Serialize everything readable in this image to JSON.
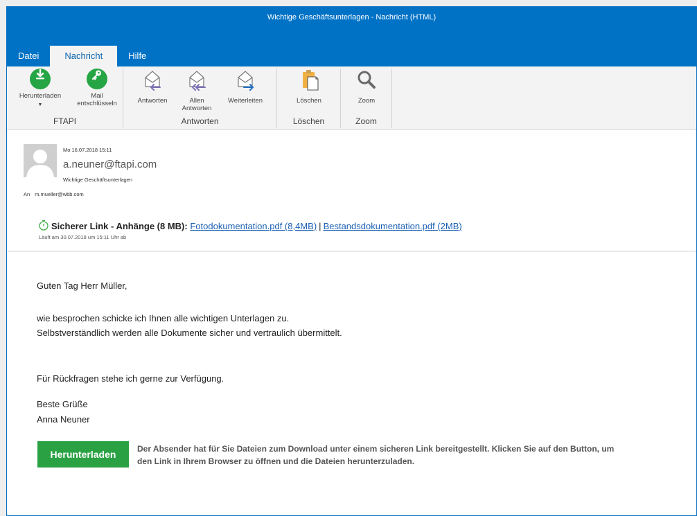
{
  "window": {
    "title": "Wichtige Geschäftsunterlagen - Nachricht (HTML)",
    "accent_color": "#0072c6"
  },
  "tabs": [
    {
      "label": "Datei",
      "active": false
    },
    {
      "label": "Nachricht",
      "active": true
    },
    {
      "label": "Hilfe",
      "active": false
    }
  ],
  "ribbon": {
    "groups": [
      {
        "label": "FTAPI",
        "buttons": [
          {
            "label": "Herunterladen",
            "icon": "download-icon",
            "dropdown": true
          },
          {
            "label": "Mail entschlüsseln",
            "icon": "key-icon"
          }
        ]
      },
      {
        "label": "Antworten",
        "buttons": [
          {
            "label": "Antworten",
            "icon": "reply-icon"
          },
          {
            "label": "Allen Antworten",
            "icon": "reply-all-icon"
          },
          {
            "label": "Weiterleiten",
            "icon": "forward-icon"
          }
        ]
      },
      {
        "label": "Löschen",
        "buttons": [
          {
            "label": "Löschen",
            "icon": "clipboard-delete-icon"
          }
        ]
      },
      {
        "label": "Zoom",
        "buttons": [
          {
            "label": "Zoom",
            "icon": "magnifier-icon"
          }
        ]
      }
    ]
  },
  "message": {
    "date": "Mo 16.07.2018 15:11",
    "sender": "a.neuner@ftapi.com",
    "subject": "Wichtige Geschäftsunterlagen",
    "to_label": "An",
    "to": "m.mueller@wbb.com",
    "secure_link_label": "Sicherer Link - Anhänge (8 MB):",
    "attachments": [
      {
        "label": "Fotodokumentation.pdf (8,4MB)"
      },
      {
        "label": "Bestandsdokumentation.pdf (2MB)"
      }
    ],
    "separator": "|",
    "expiry": "Läuft am 30.07.2018 um 15:11 Uhr ab"
  },
  "body": {
    "greeting": "Guten Tag Herr Müller,",
    "line1": "wie besprochen schicke ich Ihnen alle wichtigen Unterlagen zu.",
    "line2": "Selbstverständlich werden alle Dokumente sicher und vertraulich übermittelt.",
    "line3": "Für Rückfragen stehe ich gerne zur Verfügung.",
    "closing": "Beste Grüße",
    "signature": "Anna Neuner",
    "download_button": "Herunterladen",
    "download_info": "Der Absender hat für Sie Dateien zum Download unter einem sicheren Link bereitgestellt. Klicken Sie auf den Button, um den Link in Ihrem Browser zu öffnen und die Dateien herunterzuladen.",
    "button_color": "#2aa244"
  }
}
